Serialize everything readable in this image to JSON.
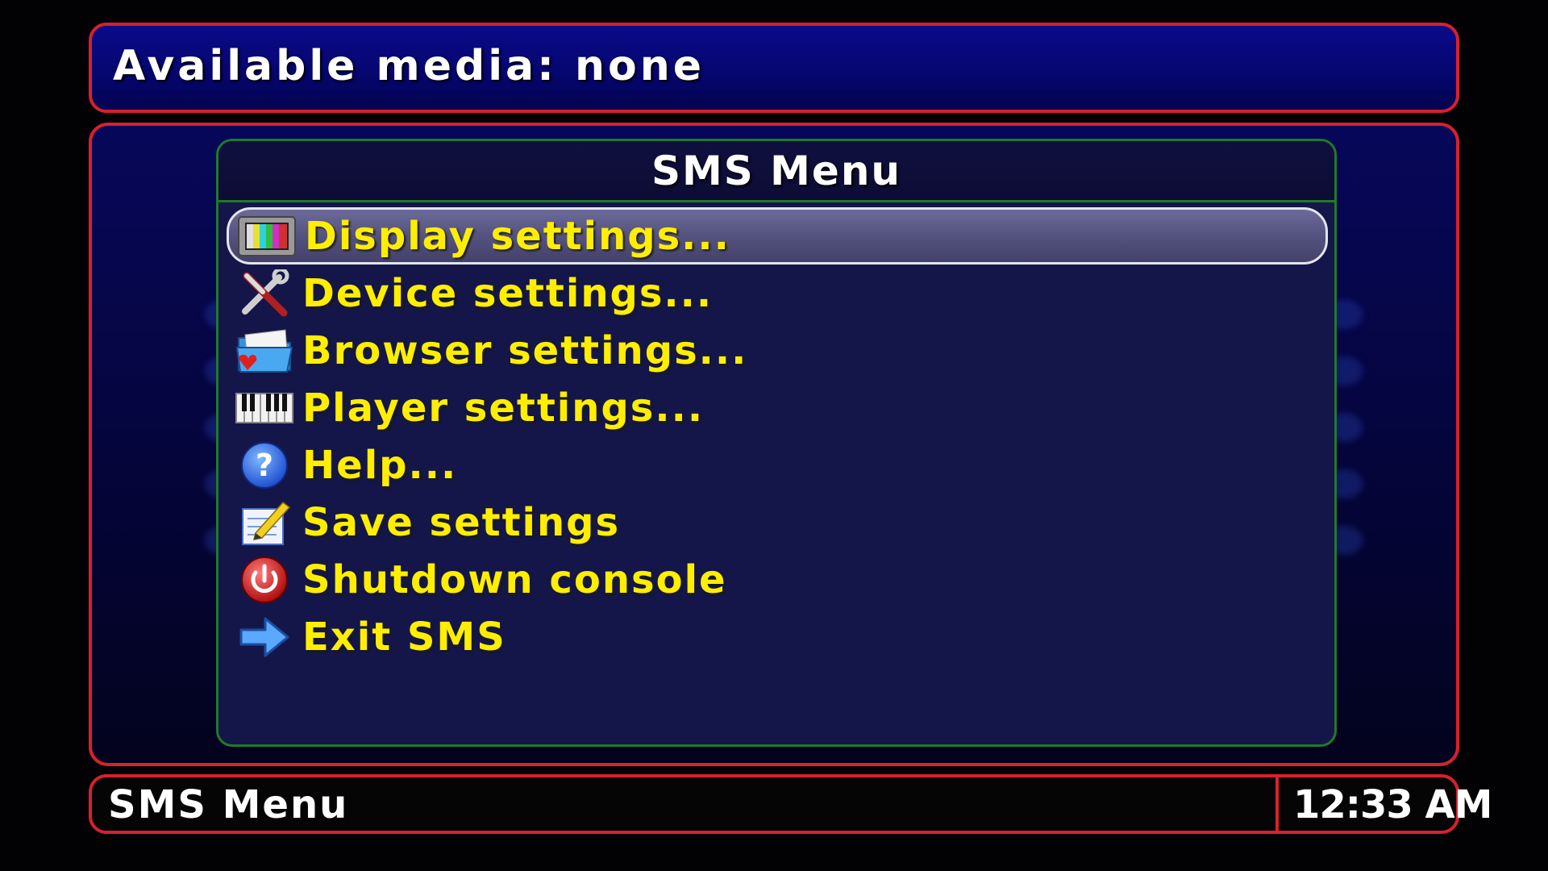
{
  "header": {
    "title": "Available media: none"
  },
  "menu": {
    "title": "SMS Menu",
    "items": [
      {
        "label": "Display settings...",
        "icon": "tv-monitor-icon",
        "selected": true
      },
      {
        "label": "Device settings...",
        "icon": "tools-icon",
        "selected": false
      },
      {
        "label": "Browser settings...",
        "icon": "folder-icon",
        "selected": false
      },
      {
        "label": "Player settings...",
        "icon": "piano-keys-icon",
        "selected": false
      },
      {
        "label": "Help...",
        "icon": "help-icon",
        "selected": false
      },
      {
        "label": "Save settings",
        "icon": "save-notepad-icon",
        "selected": false
      },
      {
        "label": "Shutdown console",
        "icon": "power-icon",
        "selected": false
      },
      {
        "label": "Exit SMS",
        "icon": "arrow-right-icon",
        "selected": false
      }
    ]
  },
  "status": {
    "title": "SMS Menu",
    "clock": "12:33 AM"
  },
  "colors": {
    "frame_border": "#d8202e",
    "panel_border": "#1f7a2a",
    "item_text": "#ffee00",
    "header_bg": "#0a0a8a"
  }
}
